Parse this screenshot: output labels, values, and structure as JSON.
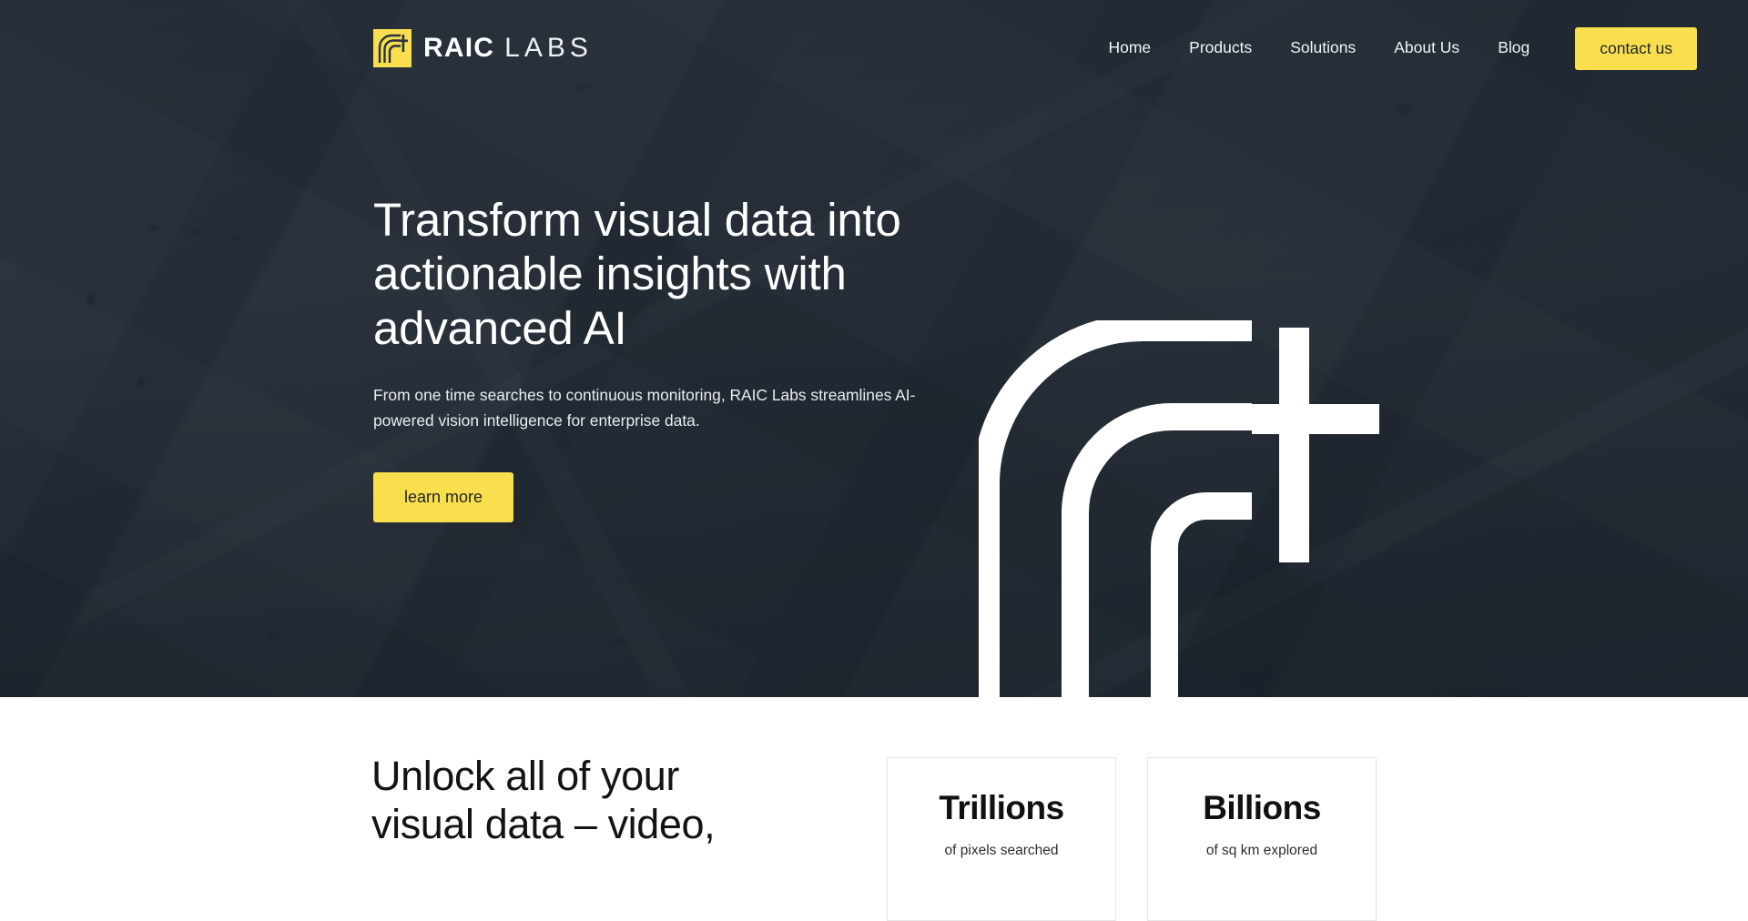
{
  "brand": {
    "logo_icon": "raic-arcs-cross-icon",
    "name_primary": "RAIC",
    "name_secondary": "LABS"
  },
  "nav": {
    "items": [
      {
        "label": "Home"
      },
      {
        "label": "Products"
      },
      {
        "label": "Solutions"
      },
      {
        "label": "About Us"
      },
      {
        "label": "Blog"
      }
    ],
    "cta_label": "contact us"
  },
  "hero": {
    "title": "Transform visual data into actionable insights with advanced AI",
    "subtitle": "From one time searches to continuous monitoring, RAIC Labs streamlines AI-powered vision intelligence for enterprise data.",
    "button_label": "learn more",
    "watermark_icon": "raic-arcs-cross-icon",
    "background_description": "dark tinted aerial satellite imagery of an urban area"
  },
  "lower": {
    "heading": "Unlock all of your visual data – video,",
    "stats": [
      {
        "value": "Trillions",
        "label": "of pixels searched"
      },
      {
        "value": "Billions",
        "label": "of sq km explored"
      }
    ]
  },
  "colors": {
    "accent_yellow": "#f9df4d",
    "hero_dark": "#232d3a",
    "text_dark": "#111315",
    "card_border": "#e6e6e6"
  }
}
